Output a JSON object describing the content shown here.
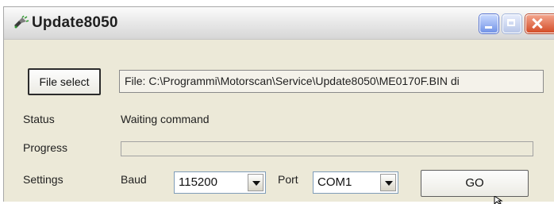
{
  "window": {
    "title": "Update8050",
    "icon": "app-icon",
    "controls": [
      "minimize-icon",
      "maximize-icon",
      "close-icon"
    ]
  },
  "file": {
    "button_label": "File select",
    "path_text": "File: C:\\Programmi\\Motorscan\\Service\\Update8050\\ME0170F.BIN di"
  },
  "status": {
    "label": "Status",
    "value": "Waiting command"
  },
  "progress": {
    "label": "Progress",
    "value": 0
  },
  "settings": {
    "label": "Settings",
    "baud_label": "Baud",
    "baud_value": "115200",
    "port_label": "Port",
    "port_value": "COM1",
    "go_label": "GO"
  }
}
